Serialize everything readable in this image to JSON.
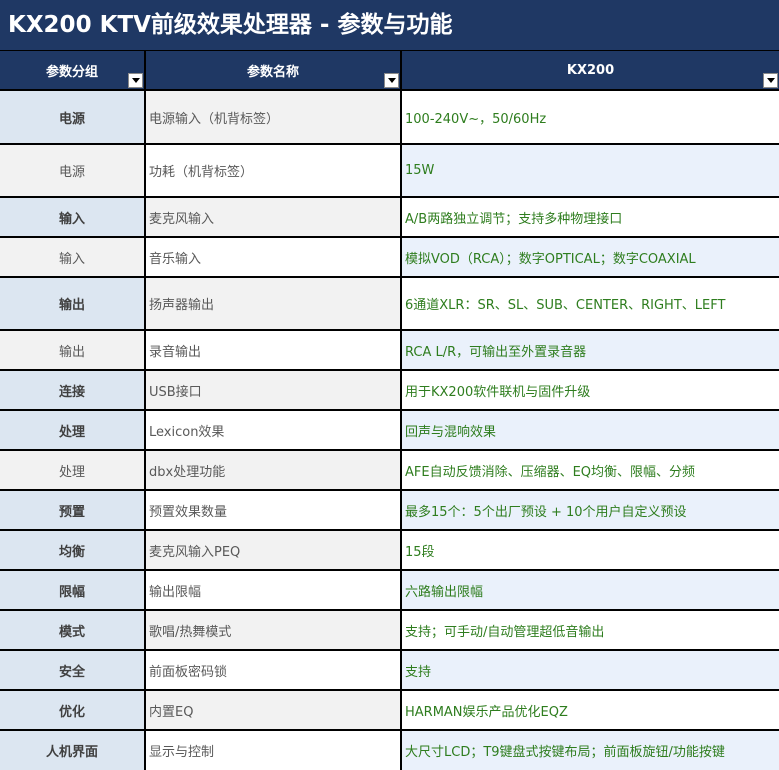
{
  "title": "KX200 KTV前级效果处理器 - 参数与功能",
  "columns": [
    "参数分组",
    "参数名称",
    "KX200"
  ],
  "rows": [
    {
      "group": "电源",
      "name": "电源输入（机背标签）",
      "value": "100-240V~，50/60Hz",
      "bold": true
    },
    {
      "group": "电源",
      "name": "功耗（机背标签）",
      "value": "15W",
      "bold": false
    },
    {
      "group": "输入",
      "name": "麦克风输入",
      "value": "A/B两路独立调节；支持多种物理接口",
      "bold": true
    },
    {
      "group": "输入",
      "name": "音乐输入",
      "value": "模拟VOD（RCA）；数字OPTICAL；数字COAXIAL",
      "bold": false
    },
    {
      "group": "输出",
      "name": "扬声器输出",
      "value": "6通道XLR：SR、SL、SUB、CENTER、RIGHT、LEFT",
      "bold": true
    },
    {
      "group": "输出",
      "name": "录音输出",
      "value": "RCA L/R，可输出至外置录音器",
      "bold": false
    },
    {
      "group": "连接",
      "name": "USB接口",
      "value": "用于KX200软件联机与固件升级",
      "bold": true
    },
    {
      "group": "处理",
      "name": "Lexicon效果",
      "value": "回声与混响效果",
      "bold": true
    },
    {
      "group": "处理",
      "name": "dbx处理功能",
      "value": "AFE自动反馈消除、压缩器、EQ均衡、限幅、分频",
      "bold": false
    },
    {
      "group": "预置",
      "name": "预置效果数量",
      "value": "最多15个：5个出厂预设 + 10个用户自定义预设",
      "bold": true
    },
    {
      "group": "均衡",
      "name": "麦克风输入PEQ",
      "value": "15段",
      "bold": true
    },
    {
      "group": "限幅",
      "name": "输出限幅",
      "value": "六路输出限幅",
      "bold": true
    },
    {
      "group": "模式",
      "name": "歌唱/热舞模式",
      "value": "支持；可手动/自动管理超低音输出",
      "bold": true
    },
    {
      "group": "安全",
      "name": "前面板密码锁",
      "value": "支持",
      "bold": true
    },
    {
      "group": "优化",
      "name": "内置EQ",
      "value": "HARMAN娱乐产品优化EQZ",
      "bold": true
    },
    {
      "group": "人机界面",
      "name": "显示与控制",
      "value": "大尺寸LCD；T9键盘式按键布局；前面板旋钮/功能按键",
      "bold": true
    }
  ],
  "colors": {
    "header_bg": "#1f3864",
    "group_bold_bg": "#dce6f1",
    "group_normal_bg": "#f2f2f2",
    "name_bg": "#f2f2f2",
    "name_alt_bg": "#ffffff",
    "value_bg": "#ffffff",
    "value_alt_bg": "#eaf1fb",
    "value_text": "#2e7d1e"
  }
}
